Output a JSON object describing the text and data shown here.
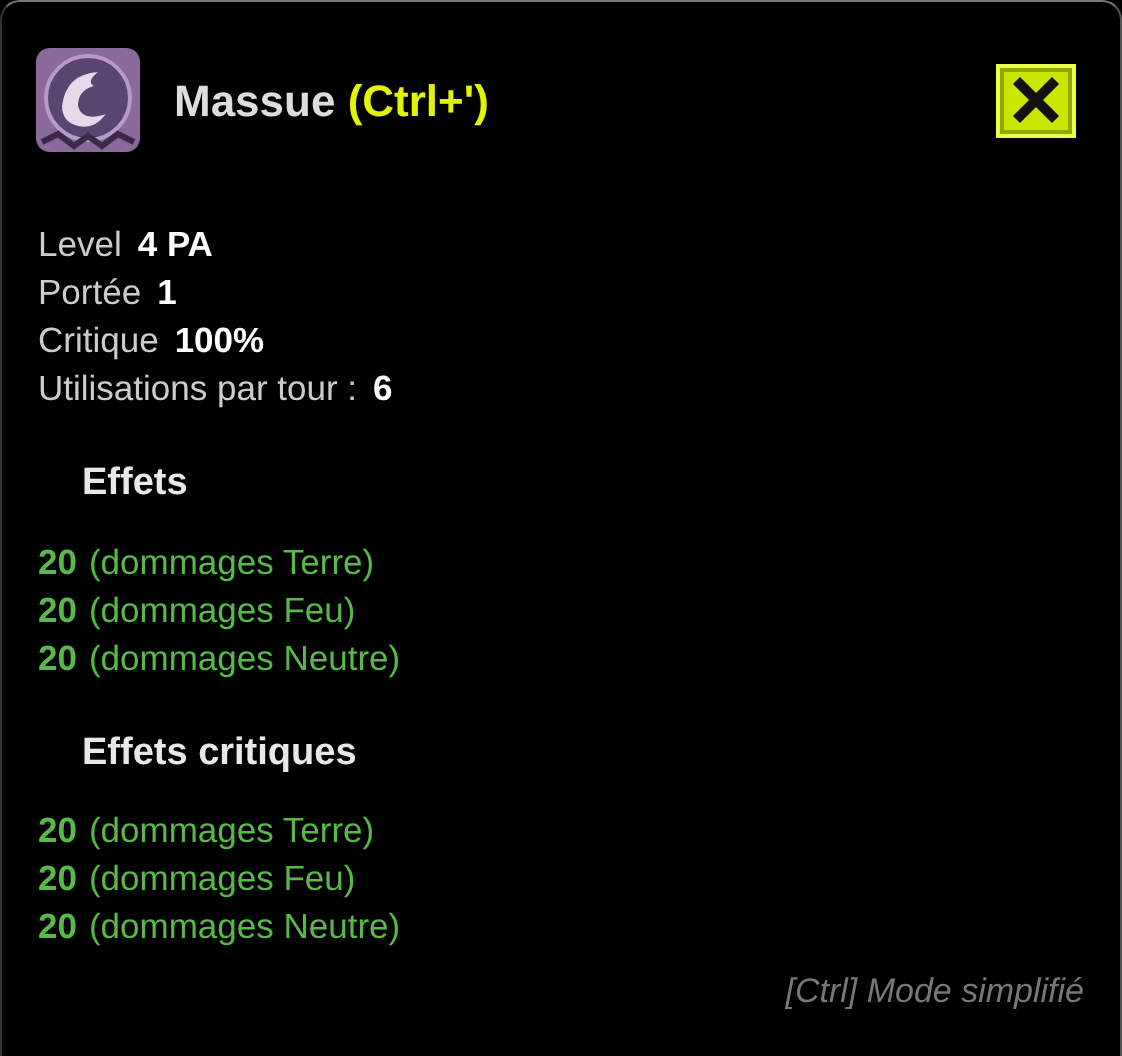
{
  "title": {
    "name": "Massue",
    "shortcut": "(Ctrl+')"
  },
  "stats": [
    {
      "label": "Level",
      "value": "4 PA"
    },
    {
      "label": "Portée",
      "value": "1"
    },
    {
      "label": "Critique",
      "value": "100%"
    },
    {
      "label": "Utilisations par tour :",
      "value": "6"
    }
  ],
  "sections": [
    {
      "heading": "Effets",
      "effects": [
        {
          "amount": "20",
          "text": "(dommages Terre)"
        },
        {
          "amount": "20",
          "text": "(dommages Feu)"
        },
        {
          "amount": "20",
          "text": "(dommages Neutre)"
        }
      ]
    },
    {
      "heading": "Effets critiques",
      "effects": [
        {
          "amount": "20",
          "text": "(dommages Terre)"
        },
        {
          "amount": "20",
          "text": "(dommages Feu)"
        },
        {
          "amount": "20",
          "text": "(dommages Neutre)"
        }
      ]
    }
  ],
  "footer": "[Ctrl] Mode simplifié"
}
